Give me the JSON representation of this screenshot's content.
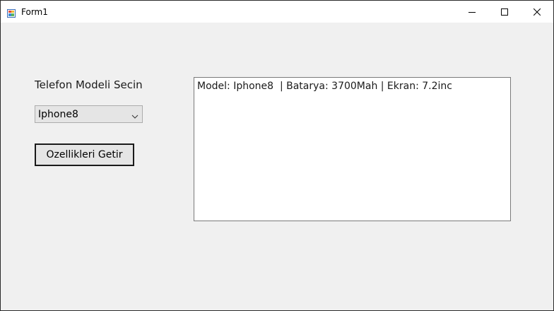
{
  "window": {
    "title": "Form1",
    "icon": "winforms-app-icon"
  },
  "caption_buttons": {
    "minimize": "minimize-icon",
    "maximize": "maximize-icon",
    "close": "close-icon"
  },
  "form": {
    "model_label": "Telefon Modeli Secin",
    "model_combo": {
      "selected": "Iphone8",
      "icon": "chevron-down-icon"
    },
    "get_features_button": "Ozellikleri Getir",
    "result_text": "Model: Iphone8  | Batarya: 3700Mah | Ekran: 7.2inc"
  }
}
